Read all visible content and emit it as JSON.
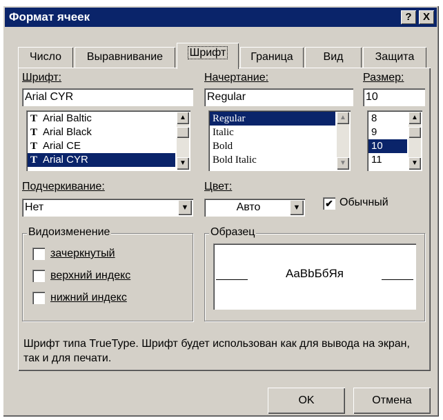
{
  "window": {
    "title": "Формат ячеек",
    "help_label": "?",
    "close_label": "X"
  },
  "tabs": [
    "Число",
    "Выравнивание",
    "Шрифт",
    "Граница",
    "Вид",
    "Защита"
  ],
  "active_tab": "Шрифт",
  "font": {
    "label": "Шрифт:",
    "value": "Arial CYR",
    "items": [
      "Arial Baltic",
      "Arial Black",
      "Arial CE",
      "Arial CYR"
    ],
    "selected": "Arial CYR",
    "tt_glyph": "T"
  },
  "style": {
    "label": "Начертание:",
    "value": "Regular",
    "items": [
      "Regular",
      "Italic",
      "Bold",
      "Bold Italic"
    ],
    "selected": "Regular"
  },
  "size": {
    "label": "Размер:",
    "value": "10",
    "items": [
      "8",
      "9",
      "10",
      "11"
    ],
    "selected": "10"
  },
  "underline": {
    "label": "Подчеркивание:",
    "value": "Нет"
  },
  "color": {
    "label": "Цвет:",
    "value": "Авто"
  },
  "normal": {
    "label": "Обычный",
    "checked": true
  },
  "effects": {
    "title": "Видоизменение",
    "strikethrough": "зачеркнутый",
    "superscript": "верхний индекс",
    "subscript": "нижний индекс"
  },
  "sample": {
    "title": "Образец",
    "text": "AaBbБбЯя"
  },
  "info": "Шрифт типа TrueType. Шрифт будет использован как для вывода на экран, так и для печати.",
  "buttons": {
    "ok": "OK",
    "cancel": "Отмена"
  },
  "colors": {
    "title_bar": "#0a246a",
    "face": "#d4d0c8",
    "selection": "#0a246a"
  },
  "icons": {
    "truetype": "truetype-icon",
    "dropdown": "chevron-down-icon",
    "scroll_up": "arrow-up-icon",
    "scroll_down": "arrow-down-icon"
  }
}
